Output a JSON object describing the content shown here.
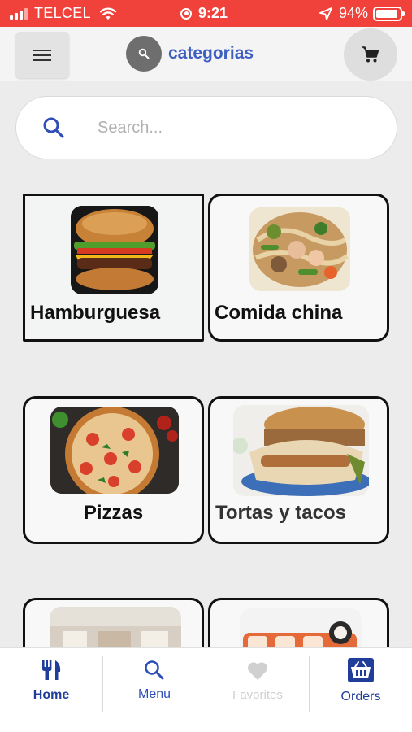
{
  "status_bar": {
    "carrier": "TELCEL",
    "time": "9:21",
    "battery": "94%",
    "battery_level": 0.94
  },
  "header": {
    "menu_icon": "hamburger-menu-icon",
    "title_icon": "search-icon",
    "title": "categorias",
    "cart_icon": "shopping-cart-icon"
  },
  "search": {
    "placeholder": "Search...",
    "value": ""
  },
  "categories": [
    {
      "label": "Hamburguesa",
      "image": "hamburger-photo"
    },
    {
      "label": "Comida china",
      "image": "chinese-food-photo"
    },
    {
      "label": "Pizzas",
      "image": "pizza-photo"
    },
    {
      "label": "Tortas y tacos",
      "image": "tortas-tacos-photo"
    },
    {
      "label": "",
      "image": "restaurant-interior-photo"
    },
    {
      "label": "",
      "image": "sushi-photo"
    }
  ],
  "bottom_nav": [
    {
      "label": "Home",
      "icon": "fork-knife-icon",
      "active": true
    },
    {
      "label": "Menu",
      "icon": "search-icon",
      "active": false
    },
    {
      "label": "Favorites",
      "icon": "heart-icon",
      "active": false,
      "disabled": true
    },
    {
      "label": "Orders",
      "icon": "basket-icon",
      "active": false
    }
  ],
  "colors": {
    "status_bar": "#f0413b",
    "accent": "#3d5fc1",
    "nav_active": "#1f3d99",
    "nav_disabled": "#d0d0d0"
  }
}
